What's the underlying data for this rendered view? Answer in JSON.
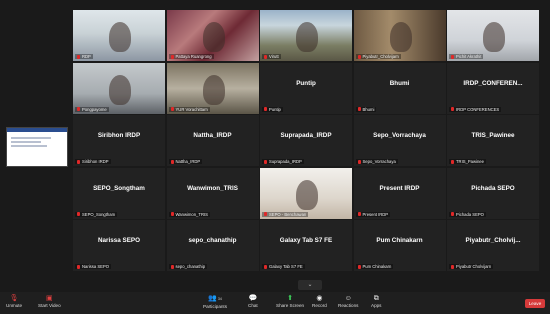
{
  "tiles": [
    {
      "name": "RDP",
      "video": true,
      "style": "v1",
      "active": true
    },
    {
      "name": "Pattaya Ruangrong",
      "video": true,
      "style": "v2"
    },
    {
      "name": "Virutt",
      "video": true,
      "style": "v3"
    },
    {
      "name": "Piyabutr_Cholvijarn",
      "video": true,
      "style": "v4"
    },
    {
      "name": "Pichit Akrathit",
      "video": true,
      "style": "v5"
    },
    {
      "name": "Pongpayome",
      "video": true,
      "style": "v6"
    },
    {
      "name": "YUR Vorachittarn",
      "video": true,
      "style": "v7"
    },
    {
      "name": "Puntip",
      "video": false,
      "display": "Puntip"
    },
    {
      "name": "Bhumi",
      "video": false,
      "display": "Bhumi"
    },
    {
      "name": "IRDP CONFERENCES",
      "video": false,
      "display": "IRDP_CONFEREN..."
    },
    {
      "name": "Siribhon IRDP",
      "video": false,
      "display": "Siribhon IRDP"
    },
    {
      "name": "Nattha_IRDP",
      "video": false,
      "display": "Nattha_IRDP"
    },
    {
      "name": "Suprapada_IRDP",
      "video": false,
      "display": "Suprapada_IRDP"
    },
    {
      "name": "Sepo_Vorrachaya",
      "video": false,
      "display": "Sepo_Vorrachaya"
    },
    {
      "name": "TRIS_Pawinee",
      "video": false,
      "display": "TRIS_Pawinee"
    },
    {
      "name": "SEPO_Songtham",
      "video": false,
      "display": "SEPO_Songtham"
    },
    {
      "name": "Wanwimon_TRIS",
      "video": false,
      "display": "Wanwimon_TRIS"
    },
    {
      "name": "SEPO - Benchawan",
      "video": true,
      "style": "v8"
    },
    {
      "name": "Present IRDP",
      "video": false,
      "display": "Present IRDP"
    },
    {
      "name": "Pichada SEPO",
      "video": false,
      "display": "Pichada SEPO"
    },
    {
      "name": "Narissa SEPO",
      "video": false,
      "display": "Narissa SEPO"
    },
    {
      "name": "sepo_chanathip",
      "video": false,
      "display": "sepo_chanathip"
    },
    {
      "name": "Galaxy Tab S7 FE",
      "video": false,
      "display": "Galaxy Tab S7 FE"
    },
    {
      "name": "Pum Chinakarn",
      "video": false,
      "display": "Pum Chinakarn"
    },
    {
      "name": "Piyabutr Cholvijarn",
      "video": false,
      "display": "Piyabutr_Cholvij..."
    }
  ],
  "toolbar": {
    "unmute": "Unmute",
    "start_video": "Start Video",
    "participants": "Participants",
    "participants_count": "34",
    "chat": "Chat",
    "share_screen": "Share Screen",
    "record": "Record",
    "reactions": "Reactions",
    "apps": "Apps",
    "leave": "Leave"
  },
  "colors": {
    "leave": "#d63a3a",
    "share": "#3ccf5a",
    "active_speaker": "#d4c81c",
    "muted_mic": "#e02828"
  }
}
